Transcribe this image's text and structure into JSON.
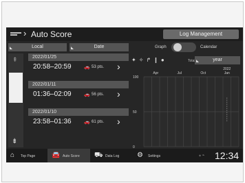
{
  "header": {
    "title": "Auto Score",
    "log_button": "Log Management"
  },
  "filters": {
    "local": "Local",
    "date": "Date"
  },
  "view_toggle": {
    "graph_label": "Graph",
    "calendar_label": "Calendar",
    "selected": "Graph"
  },
  "entries": [
    {
      "date": "2022/01/25",
      "time": "20:58–20:59",
      "points": "53 pts."
    },
    {
      "date": "2022/01/11",
      "time": "01:36–02:09",
      "points": "56 pts."
    },
    {
      "date": "2022/01/10",
      "time": "23:58–01:36",
      "points": "61 pts."
    }
  ],
  "graph_controls": {
    "total_label": "Total",
    "period": "year"
  },
  "chart_data": {
    "type": "bar",
    "categories": [
      "Apr",
      "Jul",
      "Oct",
      "2022 Jan"
    ],
    "yticks": [
      100,
      50,
      0
    ],
    "ylim": [
      0,
      100
    ],
    "grid": true,
    "values": []
  },
  "bottom_nav": [
    {
      "label": "Top Page",
      "icon": "home-icon"
    },
    {
      "label": "Auto Score",
      "icon": "car-icon",
      "active": true
    },
    {
      "label": "Data Log",
      "icon": "data-log-icon"
    },
    {
      "label": "Settings",
      "icon": "gear-icon"
    }
  ],
  "status": {
    "clock": "12:34"
  }
}
